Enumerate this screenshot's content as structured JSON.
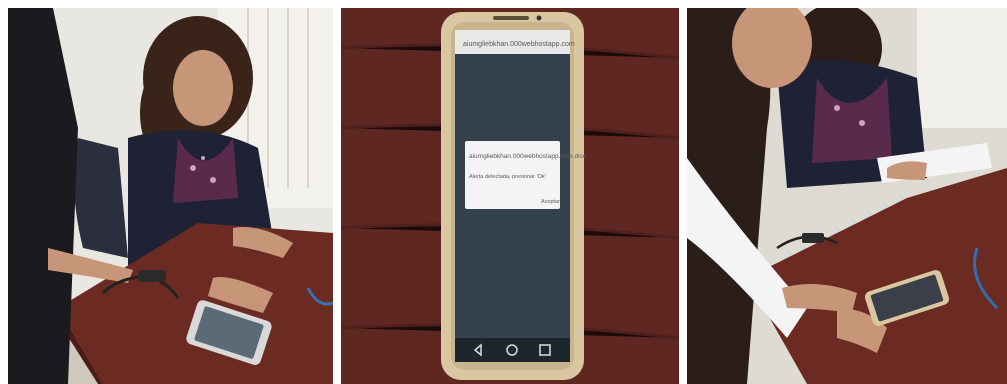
{
  "photos": [
    {
      "subject": "woman-seated-at-desk-touching-device"
    },
    {
      "subject": "smartphone-on-wooden-table-showing-browser-dialog"
    },
    {
      "subject": "two-women-using-smartphone-at-desk"
    }
  ],
  "phone": {
    "url_bar": "aiumgliebkhan.000webhostapp.com",
    "dialog_title": "aiumgliebkhan.000webhostapp.com dice",
    "dialog_message": "Alerta detectada, presionar 'Ok'",
    "dialog_button": "Aceptar"
  },
  "colors": {
    "wall": "#e8e6df",
    "desk": "#6b2a22",
    "phone_gold": "#d9c7a2",
    "screen": "#33404d"
  }
}
